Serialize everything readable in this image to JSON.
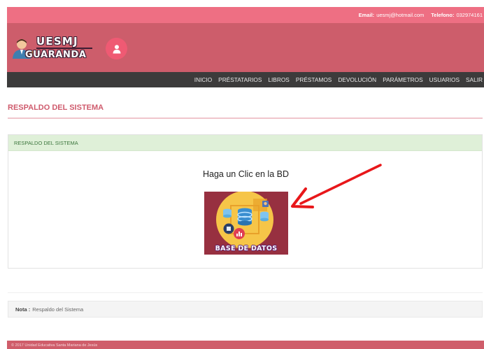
{
  "topbar": {
    "email_label": "Email:",
    "email_value": "uesmj@hotmail.com",
    "phone_label": "Telefono:",
    "phone_value": "032974161"
  },
  "brand": {
    "line1": "UESMJ",
    "line2": "GUARANDA",
    "user_icon": "user-icon"
  },
  "nav": {
    "items": [
      {
        "label": "INICIO"
      },
      {
        "label": "PRÉSTATARIOS"
      },
      {
        "label": "LIBROS"
      },
      {
        "label": "PRÉSTAMOS"
      },
      {
        "label": "DEVOLUCIÓN"
      },
      {
        "label": "PARÁMETROS"
      },
      {
        "label": "USUARIOS"
      },
      {
        "label": "SALIR"
      }
    ]
  },
  "page": {
    "title": "RESPALDO DEL SISTEMA"
  },
  "panel": {
    "heading": "RESPALDO DEL SISTEMA",
    "message": "Haga un Clic en la BD",
    "db_button_caption": "BASE DE DATOS"
  },
  "note": {
    "label": "Nota :",
    "text": "Respaldo del Sistema"
  },
  "footer": {
    "text": "© 2017 Unidad Educativa Santa Mariana de Jesús"
  },
  "colors": {
    "topbar": "#ee6f83",
    "header": "#cd5d6b",
    "navbar": "#3c3b3b",
    "accent": "#cf5b6d",
    "panel_head": "#dff0d8",
    "arrow": "#e8171a"
  }
}
